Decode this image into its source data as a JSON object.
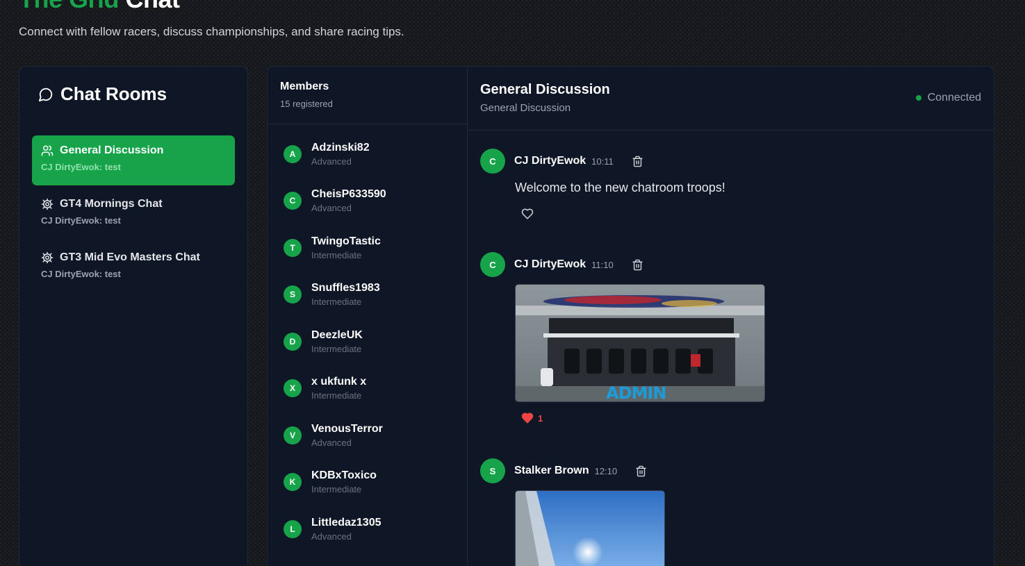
{
  "header": {
    "title_accent": "The Grid",
    "title_rest": "Chat",
    "subtitle": "Connect with fellow racers, discuss championships, and share racing tips."
  },
  "rooms": {
    "title": "Chat Rooms",
    "items": [
      {
        "name": "General Discussion",
        "last": "CJ DirtyEwok: test",
        "icon": "users-icon",
        "active": true
      },
      {
        "name": "GT4 Mornings Chat",
        "last": "CJ DirtyEwok: test",
        "icon": "gear-icon",
        "active": false
      },
      {
        "name": "GT3 Mid Evo Masters Chat",
        "last": "CJ DirtyEwok: test",
        "icon": "gear-icon",
        "active": false
      }
    ]
  },
  "members": {
    "title": "Members",
    "count": "15 registered",
    "list": [
      {
        "initial": "A",
        "name": "Adzinski82",
        "level": "Advanced"
      },
      {
        "initial": "C",
        "name": "CheisP633590",
        "level": "Advanced"
      },
      {
        "initial": "T",
        "name": "TwingoTastic",
        "level": "Intermediate"
      },
      {
        "initial": "S",
        "name": "Snuffles1983",
        "level": "Intermediate"
      },
      {
        "initial": "D",
        "name": "DeezleUK",
        "level": "Intermediate"
      },
      {
        "initial": "X",
        "name": "x ukfunk x",
        "level": "Intermediate"
      },
      {
        "initial": "V",
        "name": "VenousTerror",
        "level": "Advanced"
      },
      {
        "initial": "K",
        "name": "KDBxToxico",
        "level": "Intermediate"
      },
      {
        "initial": "L",
        "name": "Littledaz1305",
        "level": "Advanced"
      }
    ]
  },
  "conversation": {
    "title": "General Discussion",
    "subtitle": "General Discussion",
    "status": "Connected",
    "messages": [
      {
        "initial": "C",
        "author": "CJ DirtyEwok",
        "time": "10:11",
        "text": "Welcome to the new chatroom troops!"
      },
      {
        "initial": "C",
        "author": "CJ DirtyEwok",
        "time": "11:10",
        "likes": "1",
        "image_text": "ADMIN"
      },
      {
        "initial": "S",
        "author": "Stalker Brown",
        "time": "12:10"
      }
    ]
  },
  "colors": {
    "accent": "#16a34a",
    "panel": "#0f1726",
    "like": "#ef4444"
  }
}
